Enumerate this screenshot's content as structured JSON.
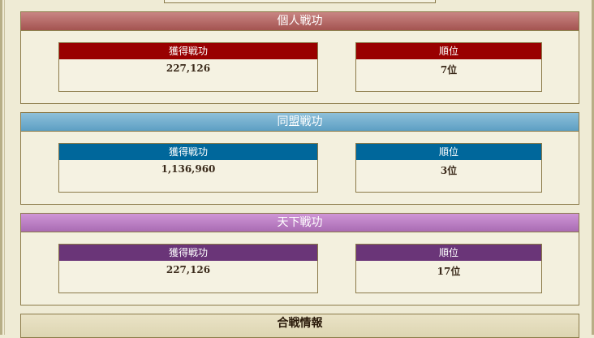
{
  "sections": [
    {
      "title": "個人戦功",
      "earned_label": "獲得戦功",
      "earned_value": "227,126",
      "rank_label": "順位",
      "rank_value": "7位"
    },
    {
      "title": "同盟戦功",
      "earned_label": "獲得戦功",
      "earned_value": "1,136,960",
      "rank_label": "順位",
      "rank_value": "3位"
    },
    {
      "title": "天下戦功",
      "earned_label": "獲得戦功",
      "earned_value": "227,126",
      "rank_label": "順位",
      "rank_value": "17位"
    }
  ],
  "battle_info": {
    "title": "合戦情報"
  },
  "colors": {
    "personal_header": "#990000",
    "alliance_header": "#00679b",
    "realm_header": "#6a3578",
    "border": "#8b7a49",
    "panel_bg": "#f3f0de"
  }
}
